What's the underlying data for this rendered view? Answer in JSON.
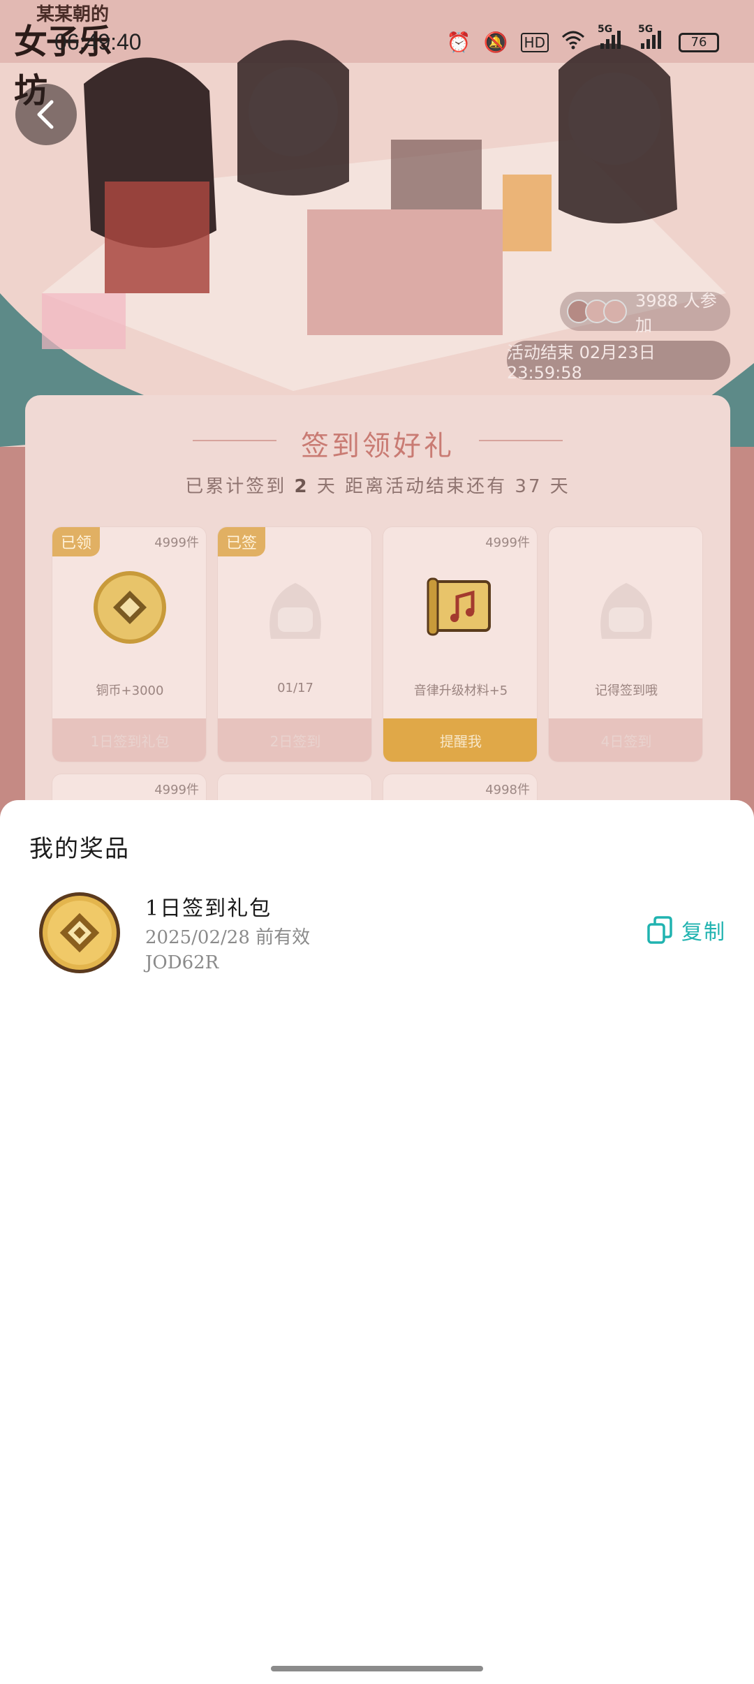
{
  "status_bar": {
    "time": "06:49:40",
    "icons": [
      "alarm-icon",
      "mute-icon",
      "hd-icon",
      "wifi-icon",
      "signal-5g-icon",
      "signal-5g-icon-2"
    ],
    "hd_label": "HD",
    "net_label_1": "5G",
    "net_label_2": "5G",
    "battery": "76"
  },
  "banner": {
    "logo_sub": "某某朝的",
    "logo_main": "女子乐坊",
    "participants": "3988 人参加",
    "event_end": "活动结束 02月23日 23:59:58"
  },
  "signin": {
    "title": "签到领好礼",
    "sub_prefix": "已累计签到",
    "sub_days": "2",
    "sub_mid": "天  距离活动结束还有 37 天",
    "days": [
      {
        "tag": "已领",
        "stock": "4999件",
        "name": "铜币+3000",
        "button": "1日签到礼包",
        "icon": "coin-icon",
        "active": false
      },
      {
        "tag": "已签",
        "stock": "",
        "name": "01/17",
        "button": "2日签到",
        "icon": "placeholder-avatar-icon",
        "active": false
      },
      {
        "tag": "",
        "stock": "4999件",
        "name": "音律升级材料+5",
        "button": "提醒我",
        "icon": "music-scroll-icon",
        "active": true
      },
      {
        "tag": "",
        "stock": "",
        "name": "记得签到哦",
        "button": "4日签到",
        "icon": "placeholder-avatar-icon",
        "active": false
      }
    ],
    "row2_stock": [
      "4999件",
      "",
      "4998件",
      ""
    ]
  },
  "sheet": {
    "title": "我的奖品",
    "prizes": [
      {
        "name": "1日签到礼包",
        "expiry": "2025/02/28 前有效",
        "code": "JOD62R",
        "copy_label": "复制",
        "icon": "coin-icon"
      }
    ]
  },
  "colors": {
    "accent_teal": "#20b3b0",
    "gold": "#e0a848",
    "card_pink": "#f0d9d4"
  }
}
